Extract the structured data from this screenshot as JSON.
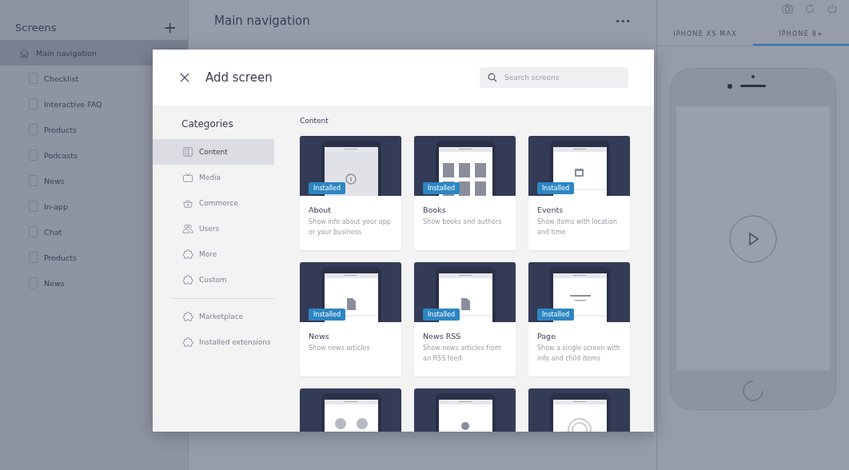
{
  "sidebar": {
    "title": "Screens",
    "add_label": "+",
    "items": [
      {
        "label": "Main navigation",
        "selected": true,
        "children": [
          {
            "label": "Checklist",
            "selected": false
          },
          {
            "label": "Interactive FAQ",
            "selected": false
          },
          {
            "label": "Products",
            "selected": false
          },
          {
            "label": "Podcasts",
            "selected": false
          },
          {
            "label": "News",
            "selected": false
          },
          {
            "label": "In-app",
            "selected": false
          },
          {
            "label": "Chat",
            "selected": false
          },
          {
            "label": "Products",
            "selected": false
          },
          {
            "label": "News",
            "selected": false
          }
        ]
      }
    ]
  },
  "main": {
    "title": "Main navigation",
    "menu_label": "•••"
  },
  "preview": {
    "tabs": [
      {
        "label": "IPHONE XS MAX",
        "selected": false
      },
      {
        "label": "IPHONE 8+",
        "selected": true
      }
    ]
  },
  "dialog": {
    "title": "Add screen",
    "search": {
      "placeholder": "Search screens"
    },
    "categories_title": "Categories",
    "categories": [
      {
        "label": "Content",
        "kind": "content",
        "selected": true
      },
      {
        "label": "Media",
        "kind": "media",
        "selected": false
      },
      {
        "label": "Commerce",
        "kind": "commerce",
        "selected": false
      },
      {
        "label": "Users",
        "kind": "users",
        "selected": false
      },
      {
        "label": "More",
        "kind": "puzzle",
        "selected": false
      },
      {
        "label": "Custom",
        "kind": "puzzle",
        "selected": false
      }
    ],
    "extensions": [
      {
        "label": "Marketplace",
        "kind": "puzzle",
        "selected": false
      },
      {
        "label": "Installed extensions",
        "kind": "puzzle",
        "selected": false
      }
    ],
    "section_title": "Content",
    "cards": [
      {
        "kind": "info",
        "title": "About",
        "description": "Show info about your app or your business",
        "badge": "Installed"
      },
      {
        "kind": "books",
        "title": "Books",
        "description": "Show books and authors",
        "badge": "Installed"
      },
      {
        "kind": "calendar",
        "title": "Events",
        "description": "Show items with location and time",
        "badge": "Installed"
      },
      {
        "kind": "document",
        "title": "News",
        "description": "Show news articles",
        "badge": "Installed"
      },
      {
        "kind": "document",
        "title": "News RSS",
        "description": "Show news articles from an RSS feed",
        "badge": "Installed"
      },
      {
        "kind": "lines",
        "title": "Page",
        "description": "Show a single screen with info and child items",
        "badge": "Installed"
      },
      {
        "kind": "people"
      },
      {
        "kind": "pin"
      },
      {
        "kind": "rings"
      }
    ]
  }
}
